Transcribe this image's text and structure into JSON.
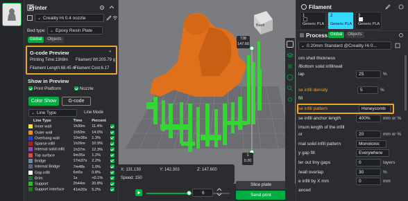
{
  "printer": {
    "title": "Printer",
    "printer_name": "Creality Hi 0.4 nozzle",
    "bed_type_label": "Bed type",
    "bed_type_value": "Epoxy Resin Plate",
    "tabs": [
      "Global",
      "Objects"
    ]
  },
  "gcode_preview": {
    "title": "G-code Preview",
    "printing_time": "Printing Time:13h9m",
    "filament_wt": "Filament Wt:205.79 g",
    "filament_length": "Filament Length:68.45 m",
    "filament_cost": "Filament Cost:6.17"
  },
  "show_in_preview": {
    "title": "Show in Preview",
    "print_platform": "Print Platform",
    "nozzle": "Nozzle",
    "color_show_btn": "Color Show",
    "gcode_btn": "G-code"
  },
  "legend": {
    "type_select": "Line Type",
    "line_mode": "Line Mode",
    "headers": [
      "Line Type",
      "Time",
      "Percent"
    ],
    "rows": [
      {
        "name": "Inner wall",
        "time": "1h30m",
        "percent": "11.4%",
        "color": "#f5e73a"
      },
      {
        "name": "Outer wall",
        "time": "1h50m",
        "percent": "14.0%",
        "color": "#f28a1c"
      },
      {
        "name": "Overhang wall",
        "time": "10m36s",
        "percent": "1.3%",
        "color": "#2e3bd6"
      },
      {
        "name": "Sparse infill",
        "time": "1h26m",
        "percent": "10.9%",
        "color": "#b01e1e"
      },
      {
        "name": "Internal solid infill",
        "time": "1h37m",
        "percent": "12.3%",
        "color": "#9b3fc0"
      },
      {
        "name": "Top surface",
        "time": "9m35s",
        "percent": "1.2%",
        "color": "#e04545"
      },
      {
        "name": "Bridge",
        "time": "17m37s",
        "percent": "2.2%",
        "color": "#6f86a6"
      },
      {
        "name": "Internal Bridge",
        "time": "7m48s",
        "percent": "1.0%",
        "color": "#5a6a80"
      },
      {
        "name": "Gap infill",
        "time": "6m5s",
        "percent": "0.8%",
        "color": "#ffffff"
      },
      {
        "name": "Brim",
        "time": "1s",
        "percent": "<0.1%",
        "color": "#1e6f3e"
      },
      {
        "name": "Support",
        "time": "2h44m",
        "percent": "20.8%",
        "color": "#22c022"
      },
      {
        "name": "Support interface",
        "time": "41m20s",
        "percent": "5.2%",
        "color": "#1c7a1c"
      }
    ]
  },
  "viewport": {
    "cube_label": "Back",
    "ruler_top": "738",
    "ruler_top2": "147.60",
    "ruler_bottom": "1",
    "ruler_bottom2": "0.20",
    "coords": {
      "x": "X: 131.130",
      "y": "Y: 142.303",
      "z": "Z: 147.600",
      "speed": "Speed: 150"
    },
    "layer_value": "6",
    "slice_btn": "Slice plate",
    "send_btn": "Send print"
  },
  "filament": {
    "title": "Filament",
    "slots": [
      {
        "num": "1",
        "label": "Generic PLA",
        "color": "#1e1e1e"
      },
      {
        "num": "2",
        "label": "Generic PLA",
        "color": "#38d7ff"
      },
      {
        "num": "3",
        "label": "Generic PLA",
        "color": "#f0f0f0"
      }
    ]
  },
  "process": {
    "title": "Process",
    "tabs": [
      "Global",
      "Objects"
    ],
    "preset": "0.20mm Standard @Creality Hi 0...",
    "settings": [
      {
        "label": "om shell thickness",
        "value": "",
        "unit": ""
      },
      {
        "label": "/Bottom solid infill/wall",
        "value": "",
        "unit": ""
      },
      {
        "label": "lap",
        "value": "25",
        "unit": "%"
      },
      {
        "label": "",
        "value": "",
        "unit": ""
      },
      {
        "label": "se infill density",
        "value": "5",
        "unit": "%"
      },
      {
        "label": "fill",
        "value": "",
        "unit": ""
      },
      {
        "label": "se infill pattern",
        "value": "Honeycomb",
        "unit": ""
      },
      {
        "label": "se infill anchor length",
        "value": "400%",
        "unit": "mm or %"
      },
      {
        "label": "imum length of the infill",
        "value": "",
        "unit": ""
      },
      {
        "label": "or",
        "value": "20",
        "unit": "mm or %"
      },
      {
        "label": "rnal solid infill pattern",
        "value": "Monotonic",
        "unit": ""
      },
      {
        "label": "y gap fill",
        "value": "Everywhere",
        "unit": ""
      },
      {
        "label": "ter out tiny gaps",
        "value": "0",
        "unit": "layers"
      },
      {
        "label": "/wall overlap",
        "value": "30",
        "unit": "%"
      },
      {
        "label": "e infill by X mm",
        "value": "0",
        "unit": "mm"
      },
      {
        "label": "anced",
        "value": "",
        "unit": ""
      }
    ]
  }
}
